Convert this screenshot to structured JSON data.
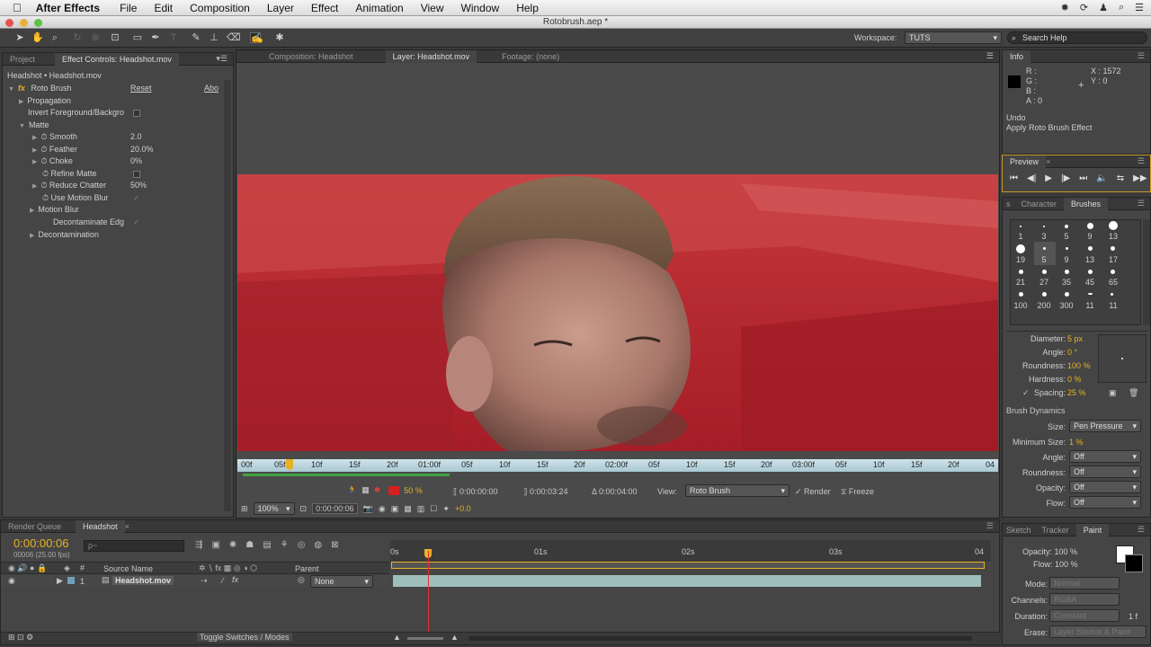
{
  "menubar": {
    "app": "After Effects",
    "items": [
      "File",
      "Edit",
      "Composition",
      "Layer",
      "Effect",
      "Animation",
      "View",
      "Window",
      "Help"
    ]
  },
  "window": {
    "title": "Rotobrush.aep *"
  },
  "toolbar": {
    "workspace_label": "Workspace:",
    "workspace_value": "TUTS",
    "search_placeholder": "Search Help"
  },
  "left_panel": {
    "tabs": [
      "Project",
      "Effect Controls: Headshot.mov"
    ],
    "breadcrumb": "Headshot • Headshot.mov",
    "effect": {
      "fx": "fx",
      "name": "Roto Brush",
      "reset": "Reset",
      "about": "Abo"
    },
    "props": {
      "propagation": "Propagation",
      "invert": "Invert Foreground/Backgro",
      "matte": "Matte",
      "smooth": "Smooth",
      "smooth_val": "2.0",
      "feather": "Feather",
      "feather_val": "20.0%",
      "choke": "Choke",
      "choke_val": "0%",
      "refine": "Refine Matte",
      "reduce": "Reduce Chatter",
      "reduce_val": "50%",
      "use_mb": "Use Motion Blur",
      "motion_blur": "Motion Blur",
      "decontaminate_edges": "Decontaminate Edg",
      "decontamination": "Decontamination"
    }
  },
  "viewer": {
    "tabs": [
      "Composition: Headshot",
      "Layer: Headshot.mov",
      "Footage: (none)"
    ],
    "ruler": [
      "00f",
      "05f",
      "10f",
      "15f",
      "20f",
      "01:00f",
      "05f",
      "10f",
      "15f",
      "20f",
      "02:00f",
      "05f",
      "10f",
      "15f",
      "20f",
      "03:00f",
      "05f",
      "10f",
      "15f",
      "20f",
      "04"
    ],
    "controls": {
      "zoom_pct": "50 %",
      "time_in": "0:00:00:00",
      "time_out": "0:00:03:24",
      "duration": "Δ 0:00:04:00",
      "view_label": "View:",
      "view_value": "Roto Brush",
      "render": "Render",
      "freeze": "Freeze",
      "magnification": "100%",
      "current_time": "0:00:00:06",
      "exposure": "+0.0"
    }
  },
  "info_panel": {
    "title": "Info",
    "r": "R :",
    "g": "G :",
    "b": "B :",
    "a": "A : 0",
    "x": "X : 1572",
    "y": "Y : 0",
    "undo": "Undo",
    "undo_action": "Apply Roto Brush Effect"
  },
  "preview_panel": {
    "title": "Preview"
  },
  "brushes_panel": {
    "tabs": [
      "s",
      "Character",
      "Brushes"
    ],
    "grid": [
      "1",
      "3",
      "5",
      "9",
      "13",
      "19",
      "5",
      "9",
      "13",
      "17",
      "21",
      "27",
      "35",
      "45",
      "65",
      "100",
      "200",
      "300",
      "11",
      "11"
    ],
    "diameter_label": "Diameter:",
    "diameter_val": "5 px",
    "angle_label": "Angle:",
    "angle_val": "0 °",
    "roundness_label": "Roundness:",
    "roundness_val": "100 %",
    "hardness_label": "Hardness:",
    "hardness_val": "0 %",
    "spacing_label": "Spacing:",
    "spacing_val": "25 %",
    "dynamics_title": "Brush Dynamics",
    "size_label": "Size:",
    "size_val": "Pen Pressure",
    "minsize_label": "Minimum Size:",
    "minsize_val": "1 %",
    "dyn_angle_label": "Angle:",
    "dyn_angle_val": "Off",
    "dyn_round_label": "Roundness:",
    "dyn_round_val": "Off",
    "opacity_label": "Opacity:",
    "opacity_val": "Off",
    "flow_label": "Flow:",
    "flow_val": "Off"
  },
  "paint_panel": {
    "tabs": [
      "Sketch",
      "Tracker",
      "Paint"
    ],
    "opacity": "Opacity: 100 %",
    "flow": "Flow: 100 %",
    "mode_label": "Mode:",
    "mode_val": "Normal",
    "channels_label": "Channels:",
    "channels_val": "RGBA",
    "duration_label": "Duration:",
    "duration_val": "Constant",
    "frames": "1 f",
    "erase_label": "Erase:",
    "erase_val": "Layer Source & Paint"
  },
  "timeline": {
    "tabs": [
      "Render Queue",
      "Headshot"
    ],
    "time": "0:00:00:06",
    "fps": "00006 (25.00 fps)",
    "search_placeholder": "ρ~",
    "col_source": "Source Name",
    "col_parent": "Parent",
    "layer_num": "1",
    "layer_name": "Headshot.mov",
    "parent_val": "None",
    "ruler": [
      "0s",
      "01s",
      "02s",
      "03s",
      "04"
    ],
    "toggle": "Toggle Switches / Modes"
  }
}
